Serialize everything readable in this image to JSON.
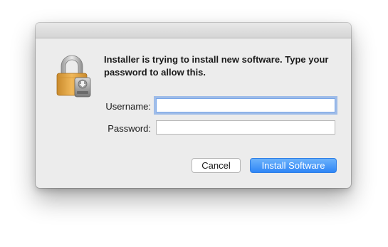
{
  "dialog": {
    "message": "Installer is trying to install new software. Type your password to allow this.",
    "icon": "padlock-installer-icon"
  },
  "form": {
    "username_label": "Username:",
    "username_value": "",
    "password_label": "Password:",
    "password_value": ""
  },
  "buttons": {
    "cancel_label": "Cancel",
    "install_label": "Install Software"
  },
  "colors": {
    "accent": "#2f86f6",
    "focus_ring": "#6096e6",
    "dialog_bg": "#ececec",
    "lock_body": "#e3a544"
  }
}
